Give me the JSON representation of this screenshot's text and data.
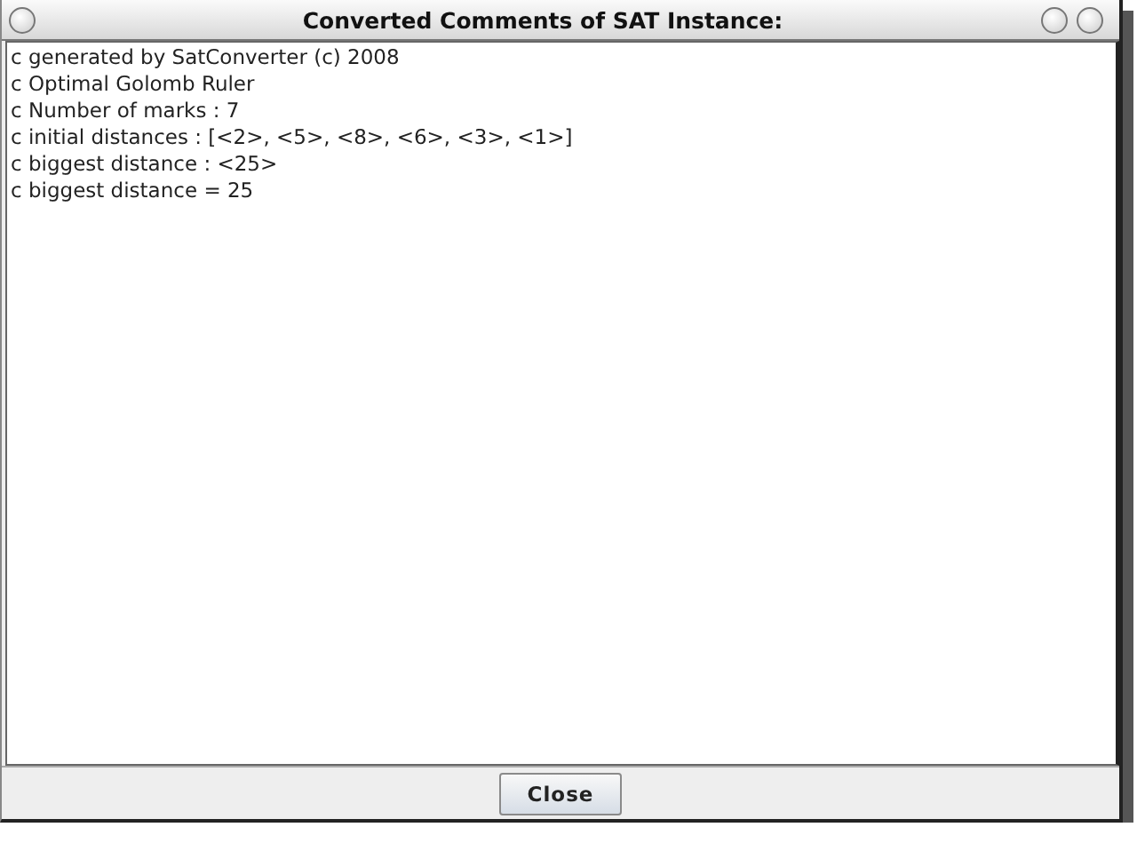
{
  "window": {
    "title": "Converted Comments of SAT Instance:"
  },
  "text_area": {
    "lines": [
      "c generated by SatConverter (c) 2008",
      "c Optimal Golomb Ruler",
      "c Number of marks : 7",
      "c initial distances : [<2>, <5>, <8>, <6>, <3>, <1>]",
      "c biggest distance : <25>",
      "c biggest distance = 25"
    ]
  },
  "buttons": [
    {
      "label": "Close"
    }
  ]
}
